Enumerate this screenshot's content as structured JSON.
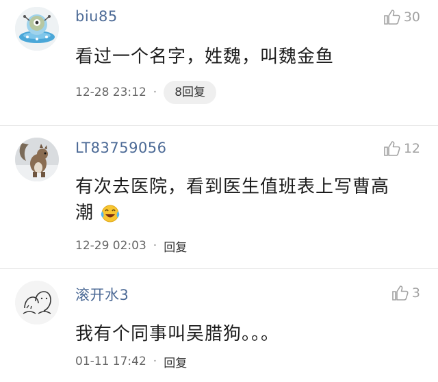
{
  "comments": [
    {
      "username": "biu85",
      "likes": "30",
      "text": "看过一个名字，姓魏，叫魏金鱼",
      "time": "12-28 23:12",
      "separator": "·",
      "reply_label": "8回复",
      "avatar_icon": "alien-ufo-avatar"
    },
    {
      "username": "LT83759056",
      "likes": "12",
      "text_line1": "有次去医院，看到医生值班表上写曹高",
      "text_line2": "潮",
      "emoji": "laugh-cry-emoji",
      "time": "12-29 02:03",
      "separator": "·",
      "reply_label": "回复",
      "avatar_icon": "squirrel-photo-avatar"
    },
    {
      "username": "滚开水3",
      "likes": "3",
      "text": "我有个同事叫吴腊狗。。。",
      "time": "01-11 17:42",
      "separator": "·",
      "reply_label": "回复",
      "avatar_icon": "hand-drawn-couple-avatar"
    }
  ],
  "colors": {
    "username": "#4c6a96",
    "text": "#1c1c1c",
    "meta": "#666666",
    "like": "#a2a2a2",
    "pill_bg": "#efefef",
    "divider": "#e6e6e6"
  }
}
